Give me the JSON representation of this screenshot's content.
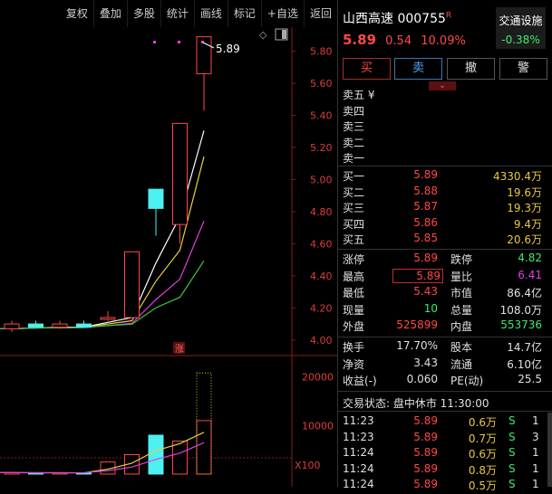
{
  "toolbar": [
    "复权",
    "叠加",
    "多股",
    "统计",
    "画线",
    "标记",
    "+自选",
    "返回"
  ],
  "stock": {
    "name": "山西高速",
    "code": "000755",
    "r_badge": "R",
    "price": "5.89",
    "change": "0.54",
    "change_pct": "10.09%",
    "sector": "交通设施",
    "sector_pct": "-0.38%"
  },
  "buttons": {
    "buy": "买",
    "sell": "卖",
    "cancel": "撤",
    "alert": "警"
  },
  "asks": [
    {
      "label": "卖五 ¥",
      "price": "",
      "vol": ""
    },
    {
      "label": "卖四",
      "price": "",
      "vol": ""
    },
    {
      "label": "卖三",
      "price": "",
      "vol": ""
    },
    {
      "label": "卖二",
      "price": "",
      "vol": ""
    },
    {
      "label": "卖一",
      "price": "",
      "vol": ""
    }
  ],
  "bids": [
    {
      "label": "买一",
      "price": "5.89",
      "vol": "4330.4万"
    },
    {
      "label": "买二",
      "price": "5.88",
      "vol": "19.6万"
    },
    {
      "label": "买三",
      "price": "5.87",
      "vol": "19.3万"
    },
    {
      "label": "买四",
      "price": "5.86",
      "vol": "9.4万"
    },
    {
      "label": "买五",
      "price": "5.85",
      "vol": "20.6万"
    }
  ],
  "stats": {
    "limit_up_label": "涨停",
    "limit_up": "5.89",
    "limit_down_label": "跌停",
    "limit_down": "4.82",
    "high_label": "最高",
    "high": "5.89",
    "vol_ratio_label": "量比",
    "vol_ratio": "6.41",
    "low_label": "最低",
    "low": "5.43",
    "mkt_cap_label": "市值",
    "mkt_cap": "86.4亿",
    "last_vol_label": "现量",
    "last_vol": "10",
    "total_vol_label": "总量",
    "total_vol": "108.0万",
    "outer_label": "外盘",
    "outer": "525899",
    "inner_label": "内盘",
    "inner": "553736",
    "turnover_label": "换手",
    "turnover": "17.70%",
    "shares_label": "股本",
    "shares": "14.7亿",
    "nav_label": "净资",
    "nav": "3.43",
    "float_label": "流通",
    "float": "6.10亿",
    "eps_label": "收益(-)",
    "eps": "0.060",
    "pe_label": "PE(动)",
    "pe": "25.5"
  },
  "trade_status": "交易状态: 盘中休市 11:30:00",
  "ticks": [
    {
      "time": "11:23",
      "price": "5.89",
      "vol": "0.6万",
      "side": "S",
      "n": "1"
    },
    {
      "time": "11:23",
      "price": "5.89",
      "vol": "0.7万",
      "side": "S",
      "n": "3"
    },
    {
      "time": "11:24",
      "price": "5.89",
      "vol": "0.6万",
      "side": "S",
      "n": "1"
    },
    {
      "time": "11:24",
      "price": "5.89",
      "vol": "0.8万",
      "side": "S",
      "n": "1"
    },
    {
      "time": "11:24",
      "price": "5.89",
      "vol": "0.5万",
      "side": "S",
      "n": "1"
    }
  ],
  "chart_data": {
    "type": "candlestick",
    "price_axis": {
      "ticks": [
        "5.80",
        "5.60",
        "5.40",
        "5.20",
        "5.00",
        "4.80",
        "4.60",
        "4.40",
        "4.20",
        "4.00"
      ],
      "range": [
        3.92,
        5.95
      ]
    },
    "volume_axis": {
      "ticks": [
        "20000",
        "10000"
      ],
      "unit_label": "X100",
      "range": [
        0,
        24000
      ]
    },
    "last_price_label": "5.89",
    "limit_up_marker": "涨",
    "candles": [
      {
        "o": 4.1,
        "h": 4.12,
        "l": 4.05,
        "c": 4.07,
        "dir": "up"
      },
      {
        "o": 4.1,
        "h": 4.12,
        "l": 4.08,
        "c": 4.08,
        "dir": "down"
      },
      {
        "o": 4.1,
        "h": 4.12,
        "l": 4.07,
        "c": 4.08,
        "dir": "up"
      },
      {
        "o": 4.1,
        "h": 4.12,
        "l": 4.08,
        "c": 4.08,
        "dir": "down"
      },
      {
        "o": 4.14,
        "h": 4.18,
        "l": 4.12,
        "c": 4.14,
        "dir": "up"
      },
      {
        "o": 4.55,
        "h": 4.55,
        "l": 4.14,
        "c": 4.14,
        "dir": "up"
      },
      {
        "o": 4.94,
        "h": 4.94,
        "l": 4.65,
        "c": 4.82,
        "dir": "down"
      },
      {
        "o": 5.35,
        "h": 5.35,
        "l": 4.6,
        "c": 4.72,
        "dir": "up"
      },
      {
        "o": 5.66,
        "h": 5.89,
        "l": 5.43,
        "c": 5.89,
        "dir": "up"
      }
    ],
    "volumes": [
      300,
      250,
      280,
      240,
      2500,
      4000,
      8000,
      6800,
      11000
    ]
  }
}
